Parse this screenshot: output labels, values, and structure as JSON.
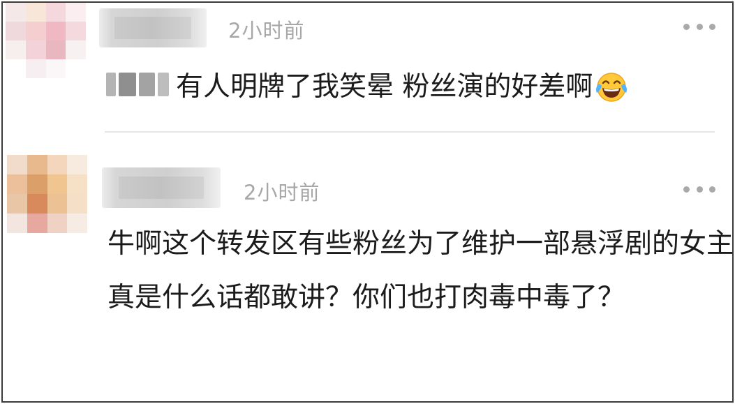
{
  "comments": [
    {
      "timestamp": "2小时前",
      "text": "有人明牌了我笑晕 粉丝演的好差啊",
      "emoji_icon": "face-with-tears-of-joy-icon",
      "avatar_colors": [
        "#f4e8e8",
        "#f8e6d8",
        "#f5d8de",
        "#fbeef0",
        "#f0d9dd",
        "#f5cfcf",
        "#efb8c2",
        "#f4dadf",
        "#f7eeee",
        "#f3d3d9",
        "#e8b7c0",
        "#f7f1f2",
        "#ffffff",
        "#f6eef0",
        "#fbf6f7",
        "#ffffff"
      ]
    },
    {
      "timestamp": "2小时前",
      "text": "牛啊这个转发区有些粉丝为了维护一部悬浮剧的女主真是什么话都敢讲？你们也打肉毒中毒了？",
      "avatar_colors": [
        "#f1dccc",
        "#e9b98e",
        "#f3d6bb",
        "#f7ebdf",
        "#ecc09a",
        "#dba06a",
        "#f0c58f",
        "#f6e1c7",
        "#e9c7a6",
        "#d98a5c",
        "#ecc294",
        "#f5dfc6",
        "#f3e6e0",
        "#e7a8a0",
        "#f0d2c4",
        "#f7ece4"
      ]
    }
  ]
}
